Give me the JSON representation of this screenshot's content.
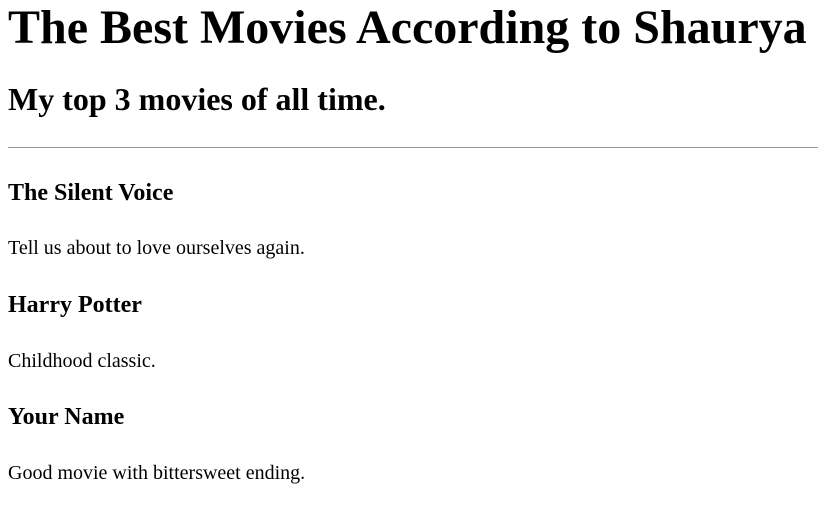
{
  "page": {
    "title": "The Best Movies According to Shaurya",
    "subtitle": "My top 3 movies of all time."
  },
  "movies": [
    {
      "title": "The Silent Voice",
      "description": "Tell us about to love ourselves again."
    },
    {
      "title": "Harry Potter",
      "description": "Childhood classic."
    },
    {
      "title": "Your Name",
      "description": "Good movie with bittersweet ending."
    }
  ]
}
